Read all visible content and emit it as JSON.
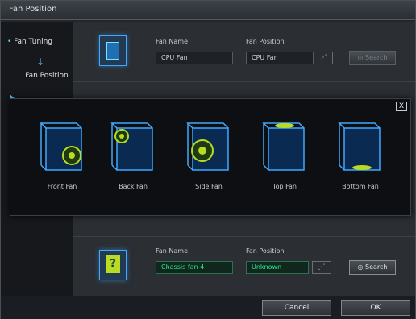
{
  "window": {
    "title": "Fan Position"
  },
  "sidebar": {
    "items": [
      {
        "label": "Fan Tuning"
      },
      {
        "label": "Fan Position"
      }
    ]
  },
  "rows": [
    {
      "fan_name_label": "Fan Name",
      "fan_name_value": "CPU Fan",
      "fan_position_label": "Fan Position",
      "fan_position_value": "CPU Fan",
      "search_label": "Search"
    },
    {
      "fan_name_label": "Fan Name",
      "fan_name_value": "Chassis fan 4",
      "fan_position_label": "Fan Position",
      "fan_position_value": "Unknown",
      "search_label": "Search"
    }
  ],
  "popup": {
    "close_label": "X",
    "cases": [
      {
        "label": "Front Fan"
      },
      {
        "label": "Back Fan"
      },
      {
        "label": "Side Fan"
      },
      {
        "label": "Top Fan"
      },
      {
        "label": "Bottom Fan"
      }
    ]
  },
  "footer": {
    "cancel_label": "Cancel",
    "ok_label": "OK"
  },
  "colors": {
    "accent": "#3fa8ff",
    "fan": "#b9dc22",
    "field_green": "#29e78f"
  }
}
